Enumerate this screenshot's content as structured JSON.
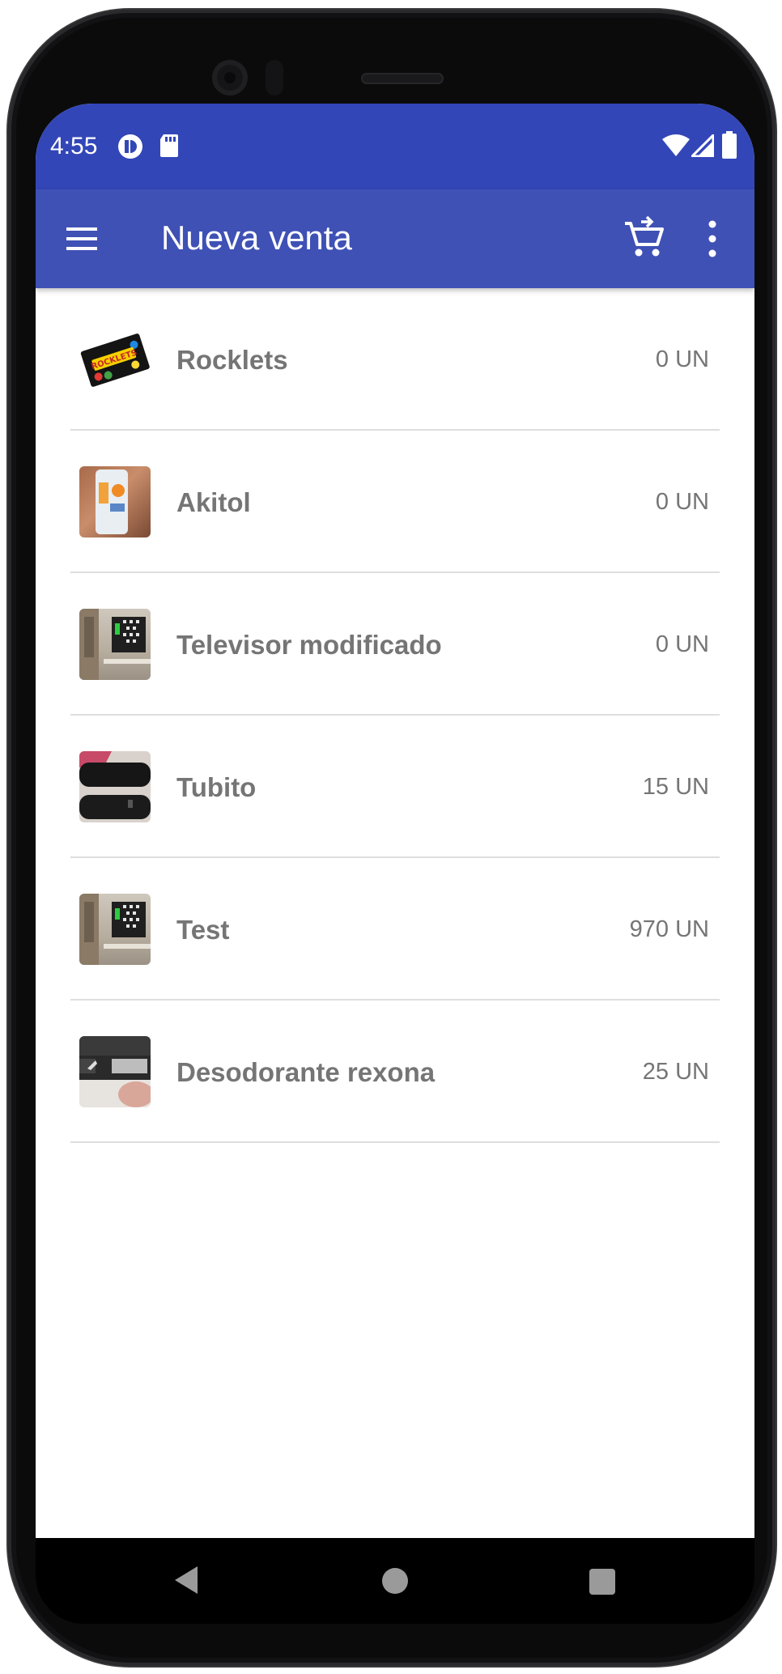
{
  "status_bar": {
    "time": "4:55"
  },
  "app_bar": {
    "title": "Nueva venta",
    "menu_icon": "menu-icon",
    "cart_icon": "add-to-cart-icon",
    "more_icon": "more-vert-icon"
  },
  "colors": {
    "status_bar": "#3346b8",
    "app_bar": "#3f51b5",
    "item_text": "#757575"
  },
  "products": [
    {
      "name": "Rocklets",
      "quantity": "0 UN",
      "thumbnail": "rocklets-image"
    },
    {
      "name": "Akitol",
      "quantity": "0 UN",
      "thumbnail": "akitol-image"
    },
    {
      "name": "Televisor modificado",
      "quantity": "0 UN",
      "thumbnail": "televisor-image"
    },
    {
      "name": "Tubito",
      "quantity": "15 UN",
      "thumbnail": "tubito-image"
    },
    {
      "name": "Test",
      "quantity": "970 UN",
      "thumbnail": "test-image"
    },
    {
      "name": "Desodorante rexona",
      "quantity": "25 UN",
      "thumbnail": "rexona-image"
    }
  ],
  "rocklets_logo": "ROCKLETS"
}
